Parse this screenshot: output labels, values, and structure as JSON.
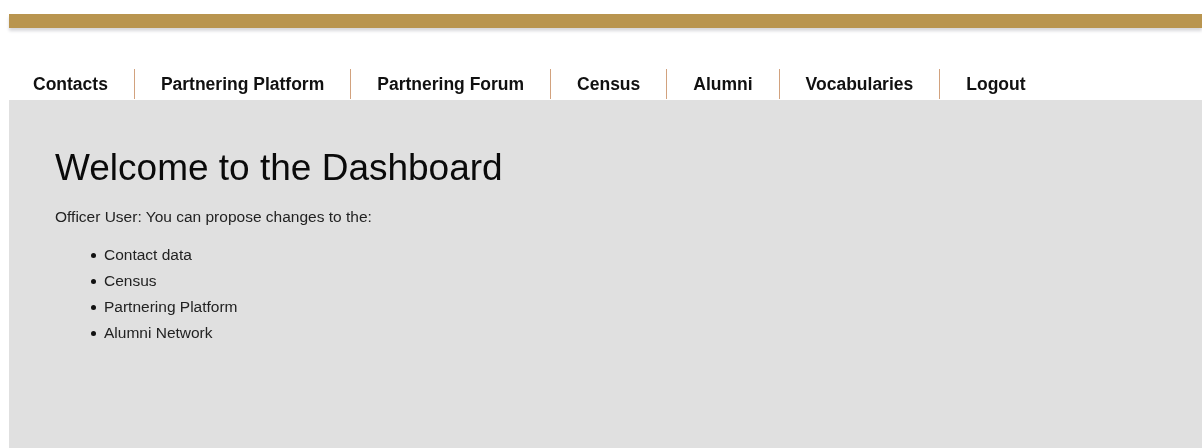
{
  "nav": {
    "items": [
      {
        "label": "Contacts"
      },
      {
        "label": "Partnering Platform"
      },
      {
        "label": "Partnering Forum"
      },
      {
        "label": "Census"
      },
      {
        "label": "Alumni"
      },
      {
        "label": "Vocabularies"
      },
      {
        "label": "Logout"
      }
    ]
  },
  "main": {
    "title": "Welcome to the Dashboard",
    "intro": "Officer User: You can propose changes to the:",
    "list": [
      "Contact data",
      "Census",
      "Partnering Platform",
      "Alumni Network"
    ]
  }
}
